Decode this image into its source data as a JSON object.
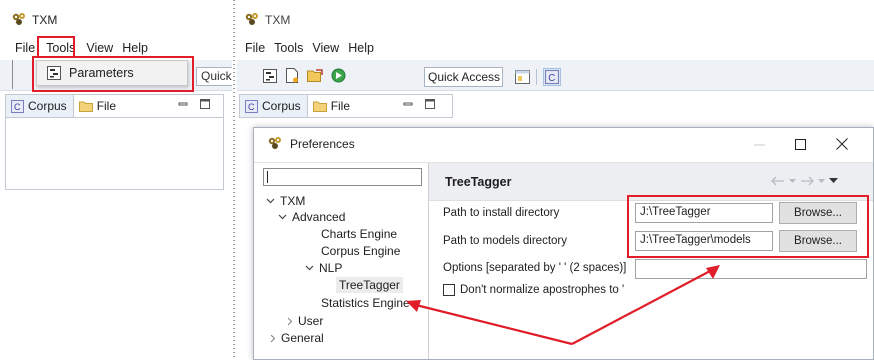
{
  "left_window": {
    "title": "TXM",
    "menu": [
      "File",
      "Tools",
      "View",
      "Help"
    ],
    "dropdown_item": "Parameters",
    "quick_access_stub": "Quick",
    "tabs": [
      "Corpus",
      "File"
    ]
  },
  "right_window": {
    "title": "TXM",
    "menu": [
      "File",
      "Tools",
      "View",
      "Help"
    ],
    "quick_access": "Quick Access",
    "tabs": [
      "Corpus",
      "File"
    ]
  },
  "preferences": {
    "title": "Preferences",
    "filter_value": "",
    "tree": {
      "txm": "TXM",
      "advanced": "Advanced",
      "charts_engine": "Charts Engine",
      "corpus_engine": "Corpus Engine",
      "nlp": "NLP",
      "treetagger": "TreeTagger",
      "statistics_engine": "Statistics Engine",
      "user": "User",
      "general": "General"
    },
    "page_title": "TreeTagger",
    "fields": {
      "install_label": "Path to install directory",
      "install_value": "J:\\TreeTagger",
      "models_label": "Path to models directory",
      "models_value": "J:\\TreeTagger\\models",
      "options_label": "Options [separated by ' ' (2 spaces)]",
      "options_value": "",
      "browse_label": "Browse...",
      "normalize_label": "Don't normalize apostrophes to '"
    },
    "normalize_checked": false
  },
  "colors": {
    "highlight_red": "#e11d2a",
    "toolbar_bg": "#eef2f7",
    "header_bg": "#eceef1"
  },
  "icons": [
    "txm-logo-icon",
    "parameters-icon",
    "corpus-icon",
    "folder-icon",
    "minimize-icon",
    "maximize-icon",
    "close-icon",
    "new-file-icon",
    "open-folder-icon",
    "run-icon",
    "perspective-icon",
    "back-arrow-icon",
    "forward-arrow-icon",
    "menu-arrow-icon"
  ]
}
